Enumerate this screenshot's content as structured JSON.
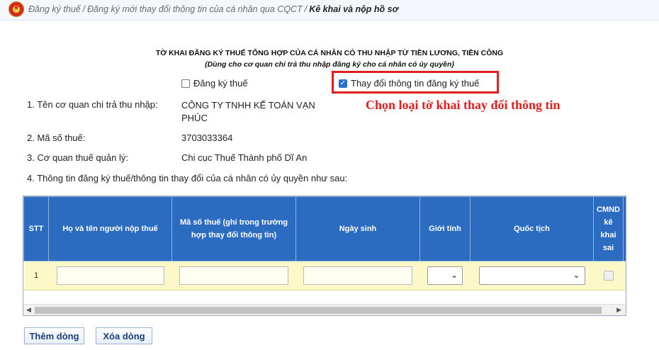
{
  "breadcrumb": {
    "items": [
      "Đăng ký thuế",
      "Đăng ký mới thay đổi thông tin của cá nhân qua CQCT"
    ],
    "current": "Kê khai và nộp hồ sơ",
    "separator": "/"
  },
  "form": {
    "title": "TỜ KHAI ĐĂNG KÝ THUẾ TỔNG HỢP CỦA CÁ NHÂN CÓ THU NHẬP TỪ TIỀN LƯƠNG, TIỀN CÔNG",
    "subtitle": "(Dùng cho cơ quan chi trả thu nhập đăng ký cho cá nhân có ủy quyền)",
    "checkbox_register": {
      "label": "Đăng ký thuế",
      "checked": false
    },
    "checkbox_change": {
      "label": "Thay đổi thông tin đăng ký thuế",
      "checked": true
    },
    "annotation": "Chọn loại tờ khai thay đổi thông tin",
    "fields": {
      "payer_label": "1. Tên cơ quan chi trả thu nhập:",
      "payer_value": "CÔNG TY TNHH KẾ TOÁN VẠN PHÚC",
      "tax_code_label": "2. Mã số thuế:",
      "tax_code_value": "3703033364",
      "tax_office_label": "3. Cơ quan thuế quản lý:",
      "tax_office_value": "Chi cục Thuế Thành phố Dĩ An",
      "info_label": "4. Thông tin đăng ký thuế/thông tin thay đổi của cá nhân có ủy quyền như sau:"
    }
  },
  "table": {
    "columns": [
      "STT",
      "Họ và tên người nộp thuế",
      "Mã số thuế (ghi trong trường hợp thay đổi thông tin)",
      "Ngày sinh",
      "Giới tính",
      "Quốc tịch",
      "CMND kê khai sai"
    ],
    "rows": [
      {
        "stt": "1"
      }
    ]
  },
  "buttons": {
    "add_row": "Thêm dòng",
    "delete_row": "Xóa dòng"
  },
  "colors": {
    "header_bg": "#2b6cc1",
    "row_bg": "#fdf8c8",
    "annotation": "#e01e1e"
  },
  "icons": {
    "emblem": "national-emblem-icon",
    "select_arrow": "chevron-down-icon"
  }
}
